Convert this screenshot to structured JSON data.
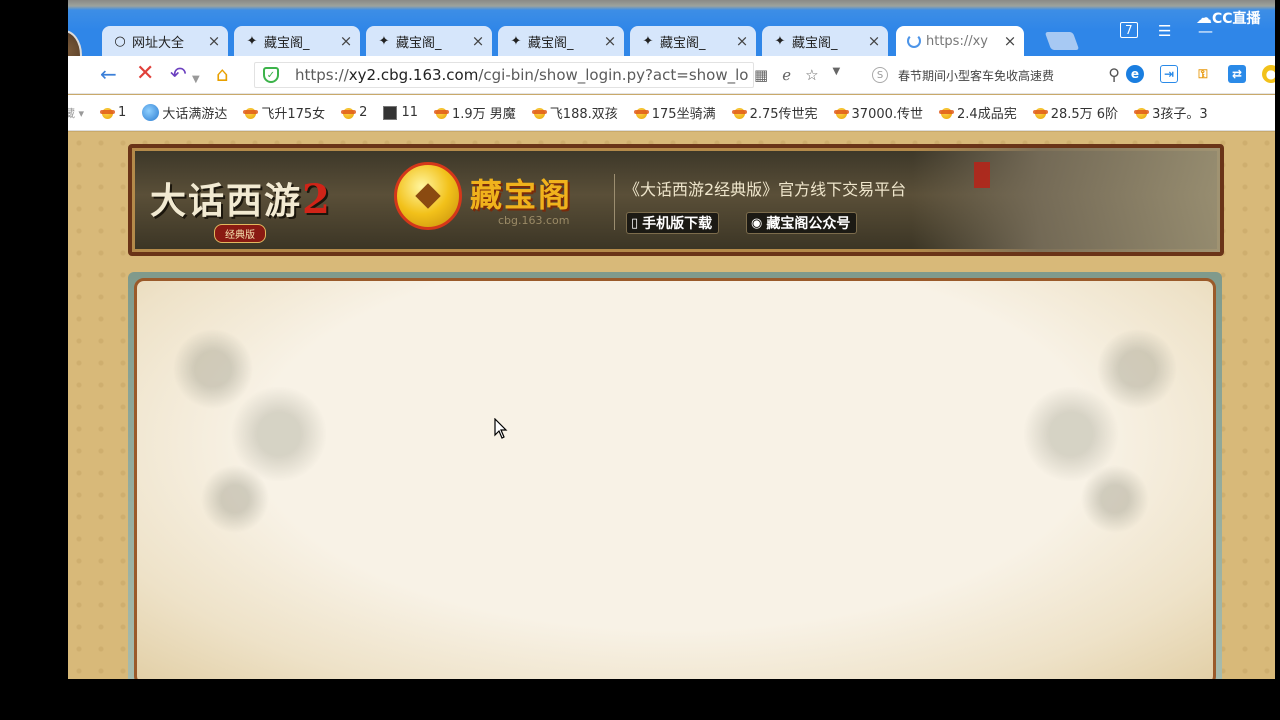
{
  "tabs": [
    {
      "label": "网址大全",
      "icon": "globe-icon"
    },
    {
      "label": "藏宝阁_",
      "icon": "cbg-favicon"
    },
    {
      "label": "藏宝阁_",
      "icon": "cbg-favicon"
    },
    {
      "label": "藏宝阁_",
      "icon": "cbg-favicon"
    },
    {
      "label": "藏宝阁_",
      "icon": "cbg-favicon"
    },
    {
      "label": "藏宝阁_",
      "icon": "cbg-favicon"
    },
    {
      "label": "https://xy",
      "icon": "loading-spinner"
    }
  ],
  "tab_close": "×",
  "window": {
    "tab_count_badge": "7",
    "brand": "CC直播"
  },
  "address_bar": {
    "url_prefix": "https://",
    "url_host": "xy2.cbg.163.com",
    "url_path": "/cgi-bin/show_login.py?act=show_lo",
    "search_text": "春节期间小型客车免收高速费"
  },
  "bookmarks": [
    {
      "label": "1",
      "icon": "cbg-favicon"
    },
    {
      "label": "大话满游达",
      "icon": "dahua-favicon"
    },
    {
      "label": "飞升175女",
      "icon": "cbg-favicon"
    },
    {
      "label": "2",
      "icon": "cbg-favicon"
    },
    {
      "label": "11",
      "icon": "dark-favicon"
    },
    {
      "label": "1.9万 男魔",
      "icon": "cbg-favicon"
    },
    {
      "label": "飞188.双孩",
      "icon": "cbg-favicon"
    },
    {
      "label": "175坐骑满",
      "icon": "cbg-favicon"
    },
    {
      "label": "2.75传世宪",
      "icon": "cbg-favicon"
    },
    {
      "label": "37000.传世",
      "icon": "cbg-favicon"
    },
    {
      "label": "2.4成品宪",
      "icon": "cbg-favicon"
    },
    {
      "label": "28.5万 6阶",
      "icon": "cbg-favicon"
    },
    {
      "label": "3孩子。3",
      "icon": "cbg-favicon"
    }
  ],
  "banner": {
    "game_logo": "大话西游",
    "game_logo_num": "2",
    "game_logo_sub": "经典版",
    "site_name": "藏宝阁",
    "site_domain": "cbg.163.com",
    "slogan": "《大话西游2经典版》官方线下交易平台",
    "mobile_download": "手机版下载",
    "wechat_account": "藏宝阁公众号"
  },
  "colors": {
    "chrome_blue": "#2f86e8",
    "page_bg": "#d8b979",
    "banner_border": "#6a3418",
    "secure_green": "#3cb34a"
  }
}
